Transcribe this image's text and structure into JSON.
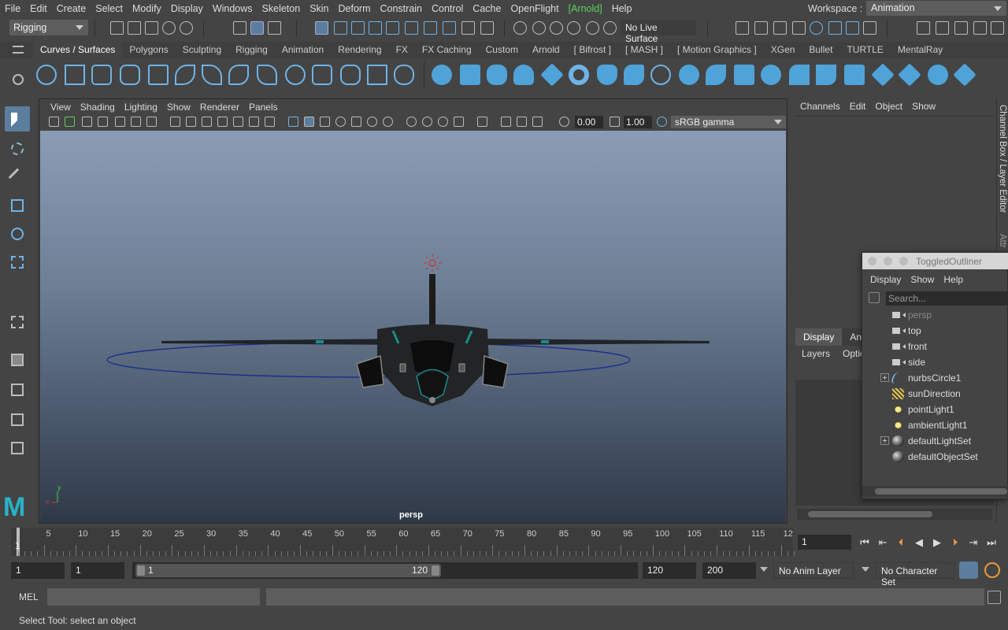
{
  "menubar": {
    "items": [
      "File",
      "Edit",
      "Create",
      "Select",
      "Modify",
      "Display",
      "Windows",
      "Skeleton",
      "Skin",
      "Deform",
      "Constrain",
      "Control",
      "Cache",
      "OpenFlight",
      "[Arnold]",
      "Help"
    ],
    "workspace_label": "Workspace :",
    "workspace_value": "Animation"
  },
  "statusline": {
    "mode": "Rigging",
    "live_surface": "No Live Surface"
  },
  "shelf": {
    "tabs": [
      "Curves / Surfaces",
      "Polygons",
      "Sculpting",
      "Rigging",
      "Animation",
      "Rendering",
      "FX",
      "FX Caching",
      "Custom",
      "Arnold",
      "[ Bifrost ]",
      "[ MASH ]",
      "[ Motion Graphics ]",
      "XGen",
      "Bullet",
      "TURTLE",
      "MentalRay"
    ],
    "active_tab": "Curves / Surfaces",
    "accent": "#4fa3d8"
  },
  "viewport": {
    "menu": [
      "View",
      "Shading",
      "Lighting",
      "Show",
      "Renderer",
      "Panels"
    ],
    "exposure": "0.00",
    "gamma": "1.00",
    "color_management": "sRGB gamma",
    "camera_label": "persp",
    "axis_y": "y",
    "axis_x": "x"
  },
  "channelbox": {
    "menu": [
      "Channels",
      "Edit",
      "Object",
      "Show"
    ],
    "layer_tabs": [
      "Display",
      "An"
    ],
    "layer_menu": [
      "Layers",
      "Optio"
    ],
    "vertical_tab": "Channel Box / Layer Editor",
    "vertical_tab2": "Attr"
  },
  "outliner": {
    "title": "ToggledOutliner",
    "menu": [
      "Display",
      "Show",
      "Help"
    ],
    "search_placeholder": "Search...",
    "items": [
      {
        "label": "persp",
        "icon": "camera-icon",
        "dim": true,
        "expandable": false
      },
      {
        "label": "top",
        "icon": "camera-icon",
        "dim": false,
        "expandable": false
      },
      {
        "label": "front",
        "icon": "camera-icon",
        "dim": false,
        "expandable": false
      },
      {
        "label": "side",
        "icon": "camera-icon",
        "dim": false,
        "expandable": false
      },
      {
        "label": "nurbsCircle1",
        "icon": "curve-icon",
        "dim": false,
        "expandable": true
      },
      {
        "label": "sunDirection",
        "icon": "directional-light-icon",
        "dim": false,
        "expandable": false
      },
      {
        "label": "pointLight1",
        "icon": "point-light-icon",
        "dim": false,
        "expandable": false
      },
      {
        "label": "ambientLight1",
        "icon": "ambient-light-icon",
        "dim": false,
        "expandable": false
      },
      {
        "label": "defaultLightSet",
        "icon": "set-icon",
        "dim": false,
        "expandable": true
      },
      {
        "label": "defaultObjectSet",
        "icon": "set-icon",
        "dim": false,
        "expandable": false
      }
    ]
  },
  "timeline": {
    "ticks": [
      "5",
      "10",
      "15",
      "20",
      "25",
      "30",
      "35",
      "40",
      "45",
      "50",
      "55",
      "60",
      "65",
      "70",
      "75",
      "80",
      "85",
      "90",
      "95",
      "100",
      "105",
      "110",
      "115",
      "12"
    ],
    "current_frame": "1",
    "current_frame_field": "1"
  },
  "range": {
    "start_field": "1",
    "start_field2": "1",
    "range_start": "1",
    "range_end": "120",
    "end_field": "120",
    "end_field2": "200",
    "anim_layer": "No Anim Layer",
    "character_set": "No Character Set"
  },
  "commandline": {
    "label": "MEL",
    "help": "Select Tool: select an object"
  }
}
